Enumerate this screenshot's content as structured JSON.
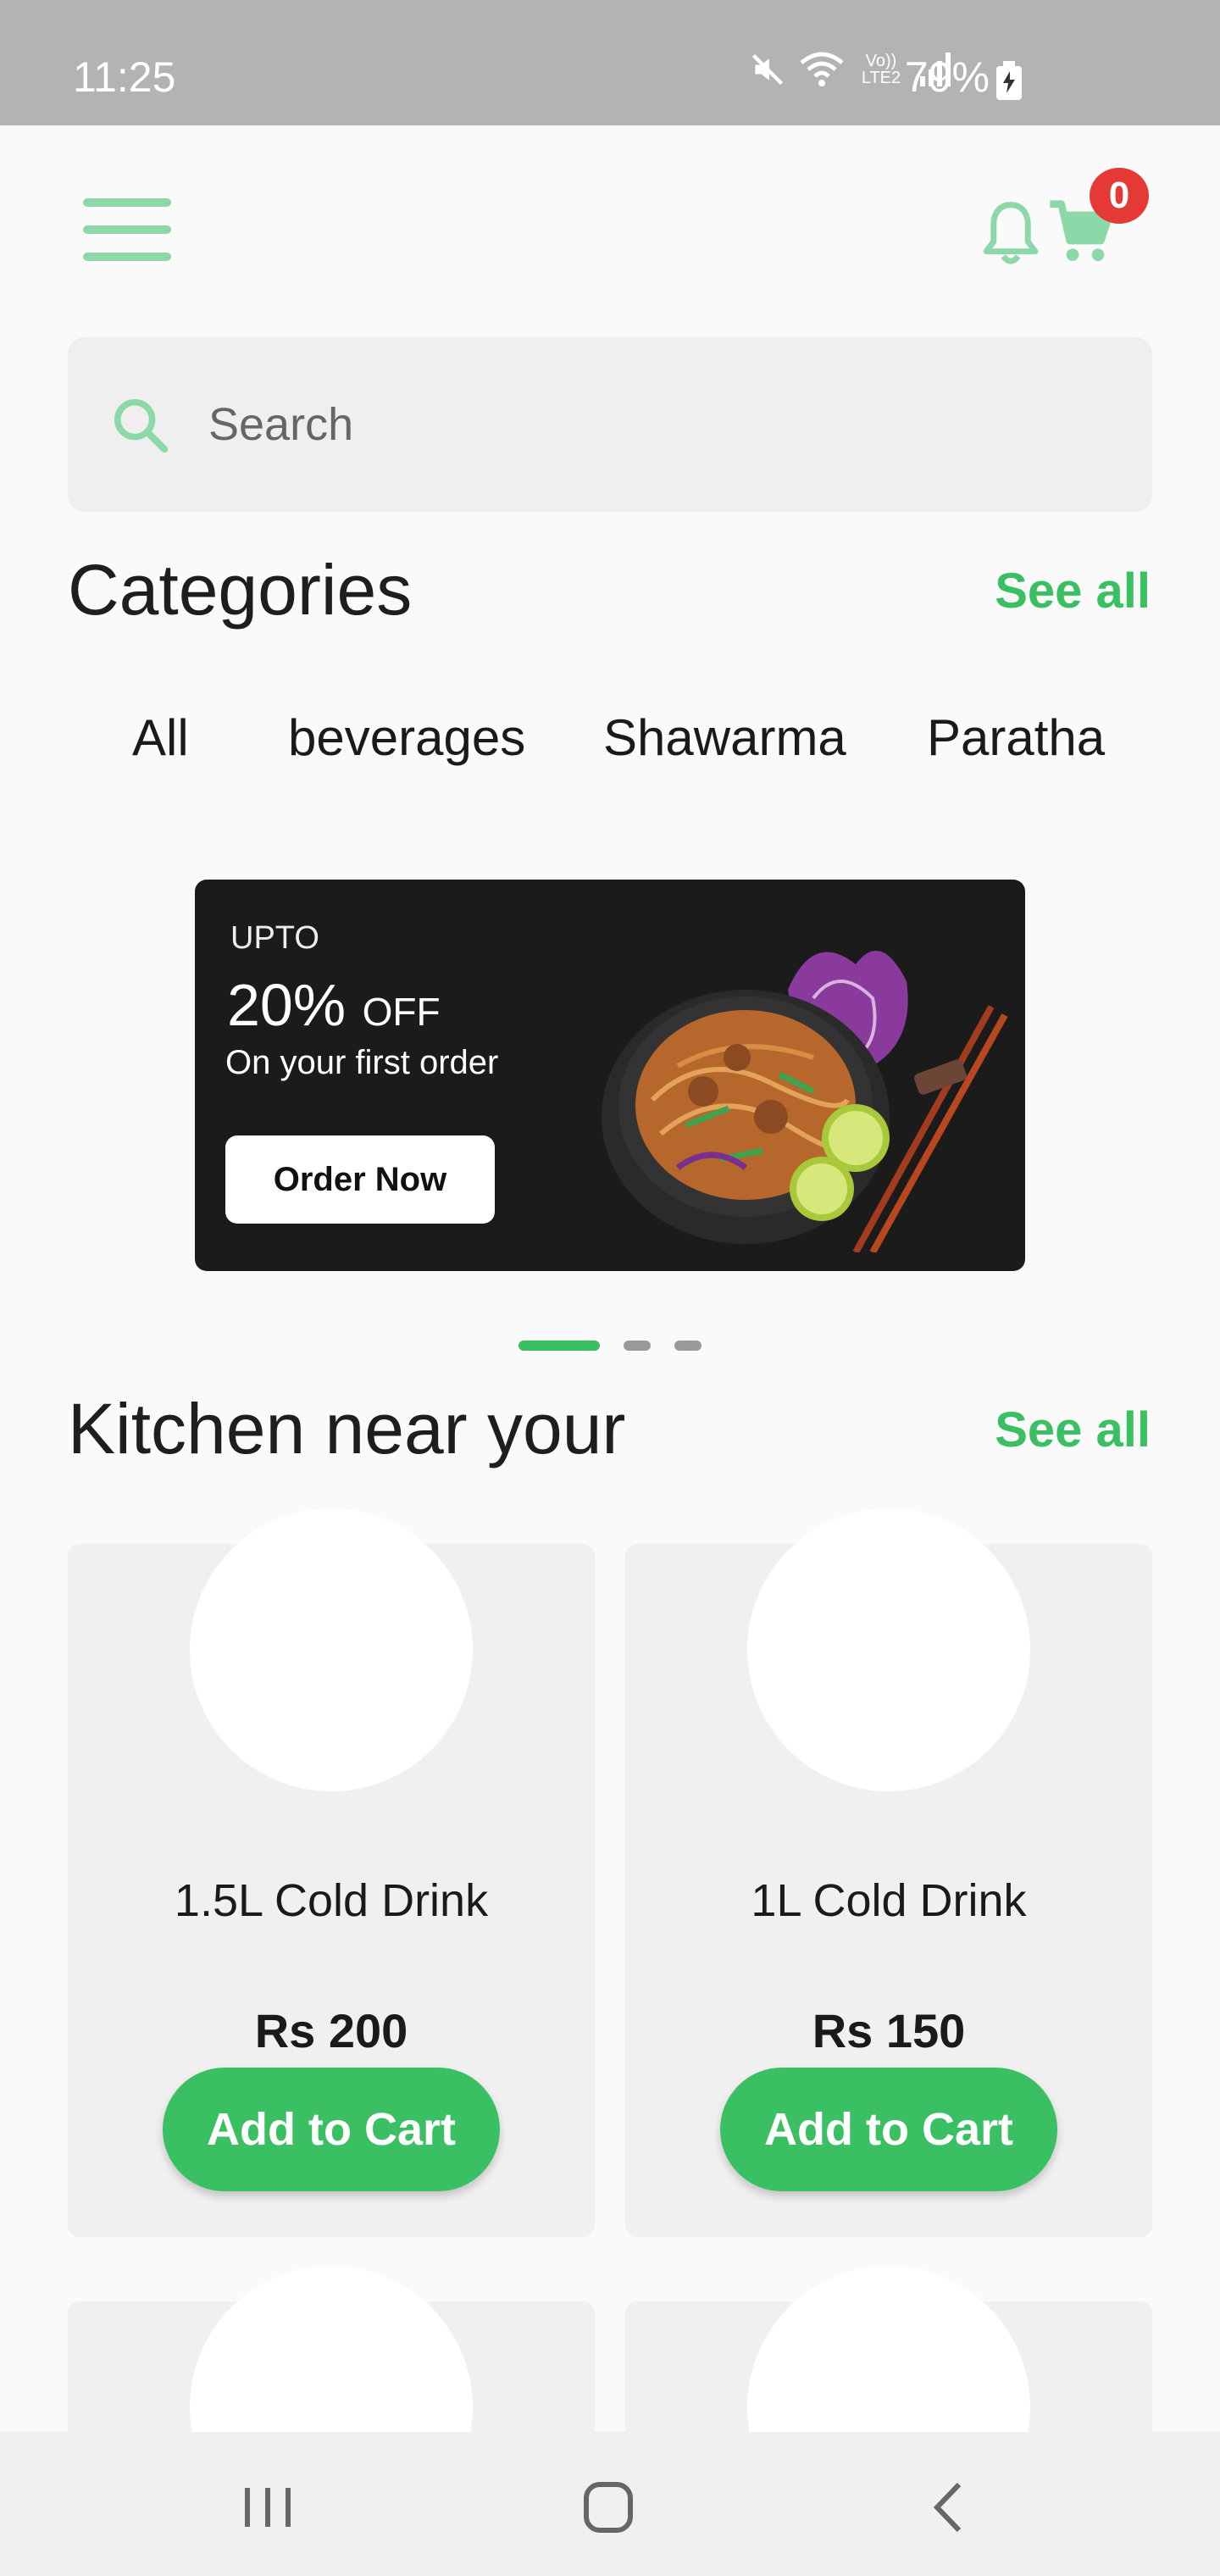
{
  "status_bar": {
    "time": "11:25",
    "network_label": "Vo)) LTE2",
    "battery": "79%"
  },
  "header": {
    "cart_count": "0"
  },
  "search": {
    "placeholder": "Search"
  },
  "categories": {
    "title": "Categories",
    "see_all": "See all",
    "items": [
      "All",
      "beverages",
      "Shawarma",
      "Paratha"
    ]
  },
  "banner": {
    "upto": "UPTO",
    "discount": "20%",
    "off": "OFF",
    "subtitle": "On your first order",
    "button": "Order Now"
  },
  "kitchen": {
    "title": "Kitchen near your",
    "see_all": "See all",
    "products": [
      {
        "name": "1.5L Cold Drink",
        "price": "Rs 200",
        "button": "Add to Cart"
      },
      {
        "name": "1L Cold Drink",
        "price": "Rs 150",
        "button": "Add to Cart"
      }
    ]
  },
  "icons": {
    "menu": "menu-icon",
    "bell": "bell-icon",
    "cart": "cart-icon",
    "search": "search-icon",
    "nav_recents": "recents-icon",
    "nav_home": "home-icon",
    "nav_back": "back-icon"
  },
  "colors": {
    "accent": "#3abf63",
    "accent_light": "#8dd8a8",
    "badge": "#e53935",
    "status_bar": "#b3b3b3",
    "banner_bg": "#1b1b1b"
  }
}
